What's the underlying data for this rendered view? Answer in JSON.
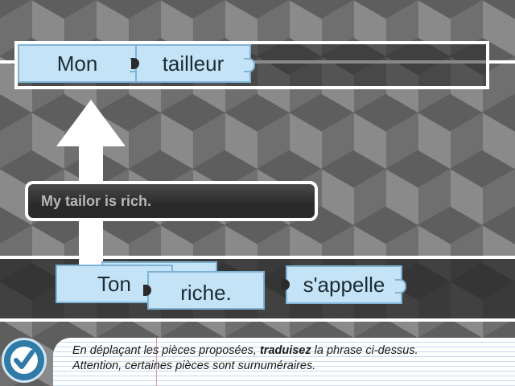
{
  "answer": {
    "pieces": [
      "Mon",
      "tailleur"
    ]
  },
  "source_sentence": "My tailor is rich.",
  "tray": {
    "pieces": [
      "Ton",
      "riche.",
      "s'appelle"
    ]
  },
  "instructions": {
    "line1_before": "En déplaçant les pièces proposées, ",
    "line1_bold": "traduisez",
    "line1_after": " la phrase ci-dessus.",
    "line2": "Attention, certaines pièces sont surnuméraires."
  },
  "icons": {
    "check": "checkmark-icon",
    "arrow": "up-arrow-icon"
  },
  "colors": {
    "piece_fill": "#c5e3f6",
    "piece_border": "#7fb3d6",
    "check_button": "#2f7aa6"
  }
}
